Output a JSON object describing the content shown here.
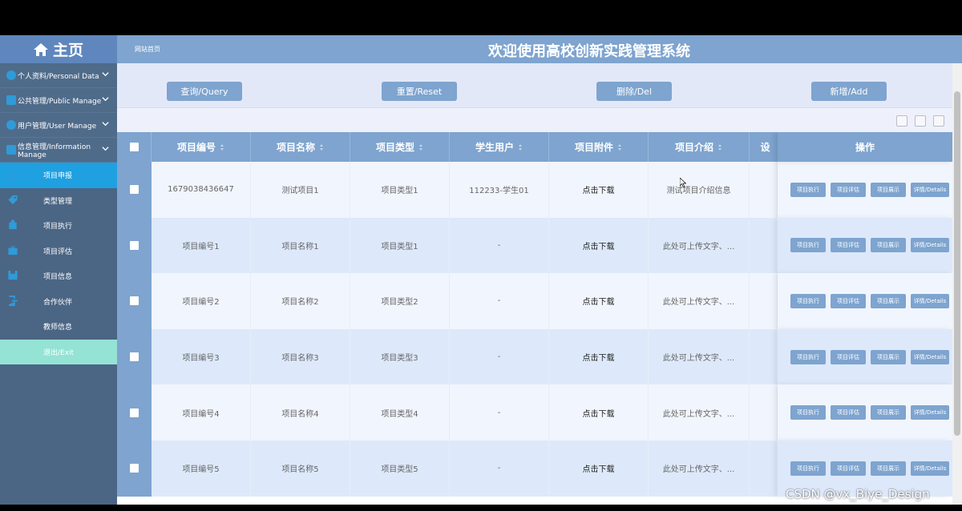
{
  "sidebar": {
    "home_label": "主页",
    "groups": [
      {
        "label": "个人资料/Personal Data"
      },
      {
        "label": "公共管理/Public Manage"
      },
      {
        "label": "用户管理/User Manage"
      },
      {
        "label": "信息管理/Information Manage"
      }
    ],
    "items": [
      {
        "label": "项目申报",
        "icon": "pen-icon"
      },
      {
        "label": "类型管理",
        "icon": "tag-icon"
      },
      {
        "label": "项目执行",
        "icon": "building-icon"
      },
      {
        "label": "项目评估",
        "icon": "briefcase-icon"
      },
      {
        "label": "项目信息",
        "icon": "save-icon"
      },
      {
        "label": "合作伙伴",
        "icon": "exit-icon"
      },
      {
        "label": "教师信息",
        "icon": ""
      },
      {
        "label": "退出/Exit",
        "icon": ""
      }
    ],
    "active_index": 0
  },
  "header": {
    "breadcrumb": "网站首页",
    "title": "欢迎使用高校创新实践管理系统"
  },
  "toolbar": {
    "query": "查询/Query",
    "reset": "重置/Reset",
    "delete": "删除/Del",
    "add": "新增/Add"
  },
  "table": {
    "columns": [
      "项目编号",
      "项目名称",
      "项目类型",
      "学生用户",
      "项目附件",
      "项目介绍",
      "设",
      "操作"
    ],
    "rows": [
      [
        "1679038436647",
        "测试项目1",
        "项目类型1",
        "112233-学生01",
        "点击下载",
        "测试项目介绍信息"
      ],
      [
        "项目编号1",
        "项目名称1",
        "项目类型1",
        "-",
        "点击下载",
        "此处可上传文字、..."
      ],
      [
        "项目编号2",
        "项目名称2",
        "项目类型2",
        "-",
        "点击下载",
        "此处可上传文字、..."
      ],
      [
        "项目编号3",
        "项目名称3",
        "项目类型3",
        "-",
        "点击下载",
        "此处可上传文字、..."
      ],
      [
        "项目编号4",
        "项目名称4",
        "项目类型4",
        "-",
        "点击下载",
        "此处可上传文字、..."
      ],
      [
        "项目编号5",
        "项目名称5",
        "项目类型5",
        "-",
        "点击下载",
        "此处可上传文字、..."
      ]
    ],
    "row_actions": [
      "项目执行",
      "项目评估",
      "项目展示",
      "详情/Details"
    ]
  },
  "watermark": "CSDN @vx_Biye_Design",
  "colors": {
    "sidebar_bg": "#4b6584",
    "header_bg": "#7ea4cf",
    "active_item": "#1fa0e0",
    "exit_item": "#94e3d4",
    "row_odd": "#f1f5fd",
    "row_even": "#dde9fa"
  }
}
